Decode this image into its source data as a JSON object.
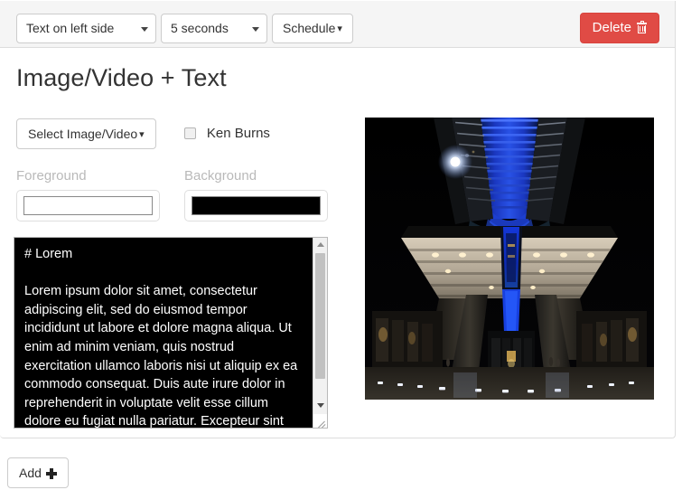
{
  "toolbar": {
    "layout_select": {
      "value": "Text on left side",
      "icon": "chevron-down-icon"
    },
    "duration_select": {
      "value": "5 seconds",
      "icon": "chevron-down-icon"
    },
    "schedule_button": {
      "label": "Schedule",
      "caret": "▾"
    },
    "delete_button": {
      "label": "Delete",
      "icon": "trash-icon",
      "color": "#e04b45"
    }
  },
  "main": {
    "title": "Image/Video + Text",
    "select_media_button": {
      "label": "Select Image/Video",
      "caret": "▾"
    },
    "ken_burns": {
      "label": "Ken Burns",
      "checked": false
    },
    "foreground": {
      "label": "Foreground",
      "color": "#ffffff"
    },
    "background": {
      "label": "Background",
      "color": "#000000"
    },
    "text_editor": {
      "value": "# Lorem\n\nLorem ipsum dolor sit amet, consectetur adipiscing elit, sed do eiusmod tempor incididunt ut labore et dolore magna aliqua. Ut enim ad minim veniam, quis nostrud exercitation ullamco laboris nisi ut aliquip ex ea commodo consequat. Duis aute irure dolor in reprehenderit in voluptate velit esse cillum dolore eu fugiat nulla pariatur. Excepteur sint occaecat cupidatat non",
      "foreground_color": "#ffffff",
      "background_color": "#000000"
    },
    "media_preview": {
      "alt": "Night photo of an illuminated skyscraper with blue neon lighting viewed from below"
    }
  },
  "footer": {
    "add_button": {
      "label": "Add",
      "icon": "plus-icon"
    }
  }
}
